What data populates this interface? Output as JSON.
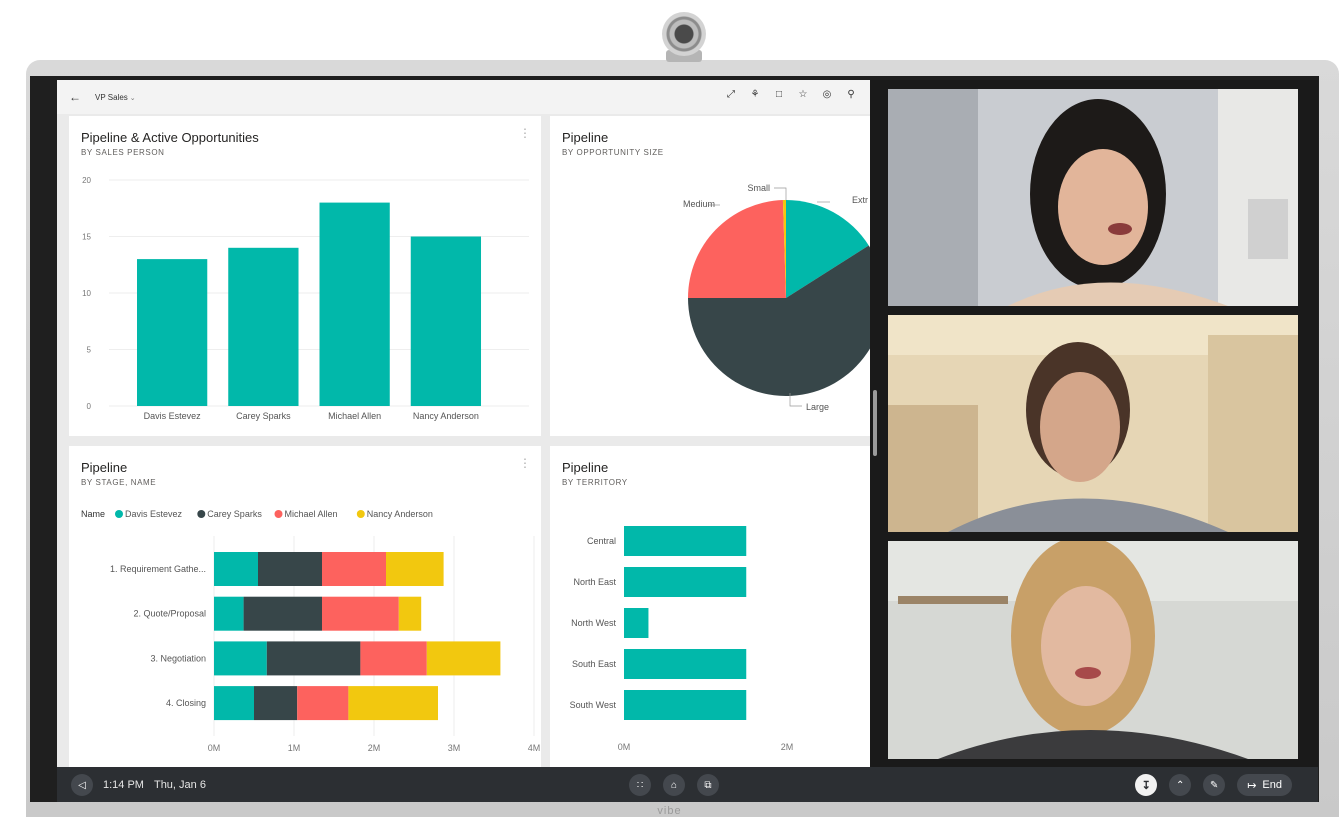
{
  "topbar": {
    "back_icon": "arrow-left-icon",
    "title": "VP Sales",
    "icons": [
      "expand-icon",
      "share-icon",
      "comment-icon",
      "favorite-icon",
      "subscribe-icon",
      "person-icon"
    ]
  },
  "cards": {
    "salesperson": {
      "title": "Pipeline & Active Opportunities",
      "subtitle": "BY SALES PERSON"
    },
    "size": {
      "title": "Pipeline",
      "subtitle": "BY OPPORTUNITY SIZE"
    },
    "stage": {
      "title": "Pipeline",
      "subtitle": "BY STAGE, NAME"
    },
    "territory": {
      "title": "Pipeline",
      "subtitle": "BY TERRITORY"
    }
  },
  "colors": {
    "teal": "#01B8AA",
    "dark": "#374649",
    "red": "#FD625E",
    "yellow": "#F2C80F"
  },
  "chart_data": [
    {
      "type": "bar",
      "title": "Pipeline & Active Opportunities",
      "subtitle": "BY SALES PERSON",
      "categories": [
        "Davis Estevez",
        "Carey Sparks",
        "Michael Allen",
        "Nancy Anderson"
      ],
      "values": [
        13,
        14,
        18,
        15
      ],
      "yticks": [
        "0",
        "5",
        "10",
        "15",
        "20"
      ],
      "ylim": [
        0,
        20
      ],
      "grid": true
    },
    {
      "type": "pie",
      "title": "Pipeline",
      "subtitle": "BY OPPORTUNITY SIZE",
      "slices": [
        {
          "label": "Extra Large",
          "label_visible": "Extr",
          "value": 16
        },
        {
          "label": "Large",
          "value": 59
        },
        {
          "label": "Medium",
          "value": 24.5
        },
        {
          "label": "Small",
          "value": 0.5
        }
      ]
    },
    {
      "type": "bar",
      "orientation": "horizontal",
      "stacked": true,
      "title": "Pipeline",
      "subtitle": "BY STAGE, NAME",
      "legend_title": "Name",
      "categories": [
        "1. Requirement Gathe...",
        "2. Quote/Proposal",
        "3. Negotiation",
        "4. Closing"
      ],
      "series": [
        {
          "name": "Davis Estevez",
          "values": [
            0.55,
            0.37,
            0.66,
            0.5
          ]
        },
        {
          "name": "Carey Sparks",
          "values": [
            0.8,
            0.98,
            1.17,
            0.54
          ]
        },
        {
          "name": "Michael Allen",
          "values": [
            0.8,
            0.96,
            0.83,
            0.64
          ]
        },
        {
          "name": "Nancy Anderson",
          "values": [
            0.72,
            0.28,
            0.92,
            1.12
          ]
        }
      ],
      "xticks": [
        "0M",
        "1M",
        "2M",
        "3M",
        "4M"
      ],
      "xlim": [
        0,
        4
      ]
    },
    {
      "type": "bar",
      "orientation": "horizontal",
      "title": "Pipeline",
      "subtitle": "BY TERRITORY",
      "categories": [
        "Central",
        "North East",
        "North West",
        "South East",
        "South West"
      ],
      "values": [
        1.5,
        1.5,
        0.3,
        1.5,
        1.5
      ],
      "xticks": [
        "0M",
        "2M"
      ],
      "xlim": [
        0,
        4
      ]
    }
  ],
  "video": {
    "participants": [
      {
        "name_icon": "participant-video-1"
      },
      {
        "name_icon": "participant-video-2"
      },
      {
        "name_icon": "participant-video-3"
      }
    ]
  },
  "taskbar": {
    "time": "1:14 PM",
    "date": "Thu, Jan 6",
    "back_icon": "triangle-left-icon",
    "apps_icon": "grid-icon",
    "home_icon": "home-icon",
    "windows_icon": "windows-icon",
    "download_icon": "download-icon",
    "chevron_icon": "chevron-up-icon",
    "pen_icon": "pen-icon",
    "end_label": "End"
  },
  "brand": "vibe"
}
